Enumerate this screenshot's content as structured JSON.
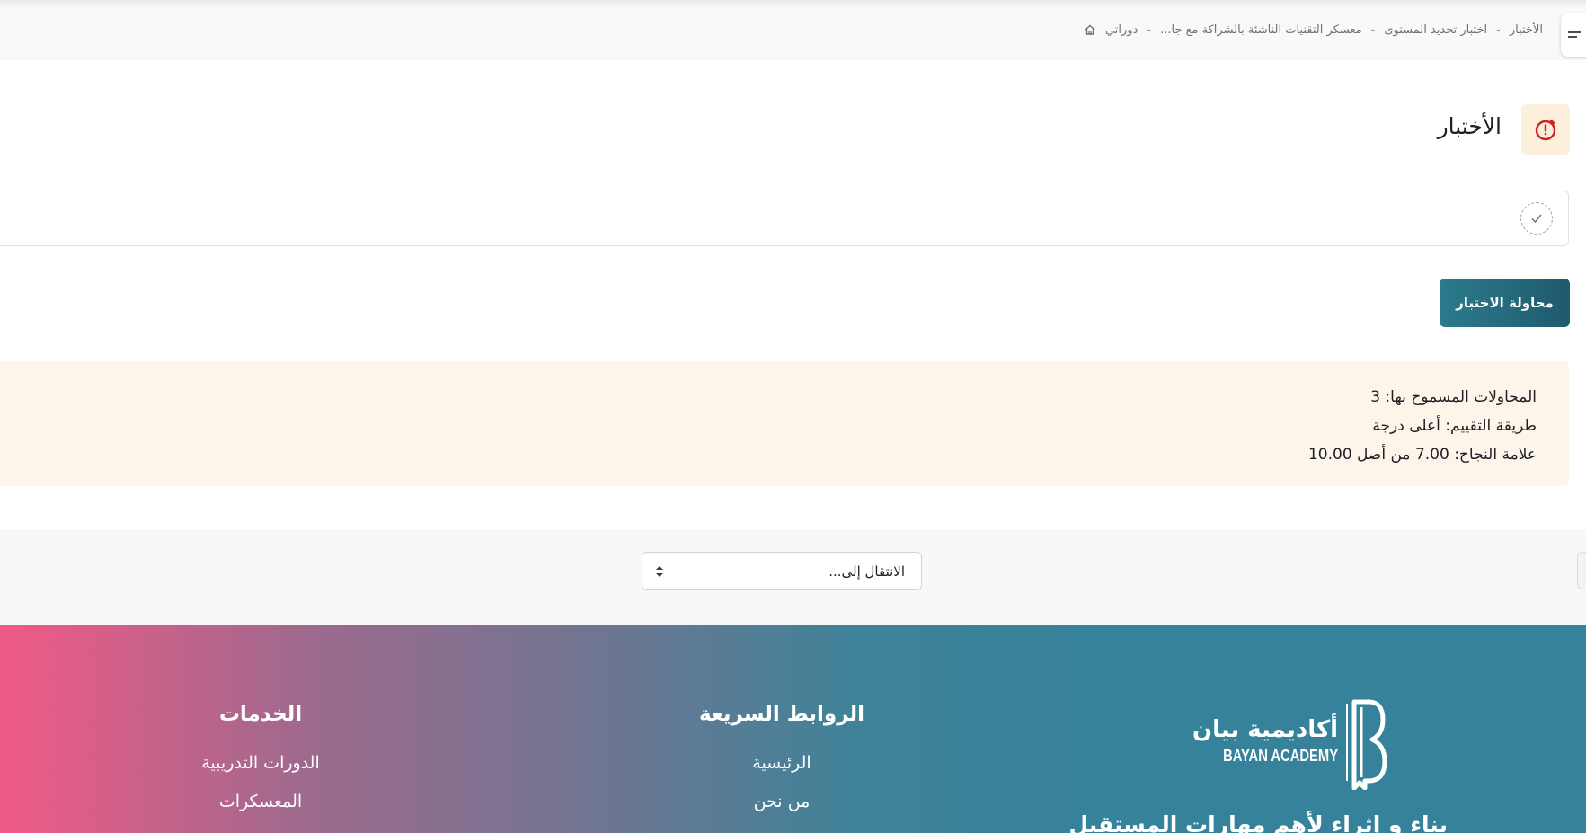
{
  "breadcrumb": {
    "items": [
      {
        "label": "دوراتي"
      },
      {
        "label": "معسكر التقنيات الناشئة بالشراكة مع جا..."
      },
      {
        "label": "اختبار تحديد المستوى"
      },
      {
        "label": "الأختبار"
      }
    ],
    "separator": "-"
  },
  "activity": {
    "title": "الأختبار",
    "icon": "quiz-timer-icon",
    "icon_color": "#d11f1f"
  },
  "completion": {
    "icon": "check-circle-icon"
  },
  "attempt_button": {
    "label": "محاولة الاختبار"
  },
  "quiz_info": {
    "attempts_allowed": "المحاولات المسموح بها: 3",
    "grading_method": "طريقة التقييم: أعلى درجة",
    "pass_grade": "علامة النجاح: 7.00 من أصل 10.00"
  },
  "jump_to": {
    "selected": "الانتقال إلى..."
  },
  "footer": {
    "logo_ar": "أكاديمية بيان",
    "logo_en": "BAYAN ACADEMY",
    "tagline": "بناء و إثراء لأهم مهارات المستقبل",
    "quick_links": {
      "title": "الروابط السريعة",
      "items": [
        "الرئيسية",
        "من نحن"
      ]
    },
    "services": {
      "title": "الخدمات",
      "items": [
        "الدورات التدريبية",
        "المعسكرات"
      ]
    }
  },
  "colors": {
    "accent": "#2c7b8d",
    "info_bg": "#fdf5ea",
    "footer_pink": "#f05a86",
    "footer_teal": "#35829a"
  }
}
